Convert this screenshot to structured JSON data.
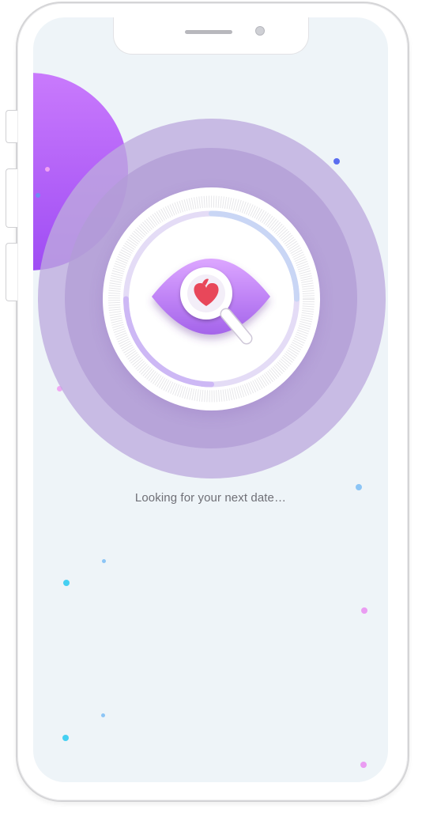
{
  "status": {
    "message": "Looking for your next date…"
  },
  "icons": {
    "center": "eye-heart-search-icon"
  },
  "colors": {
    "screen_background": "#eef4f8",
    "accent_purple": "#b07ff0",
    "heart": "#e8475a",
    "progress_arc": "#c9d6f5"
  }
}
